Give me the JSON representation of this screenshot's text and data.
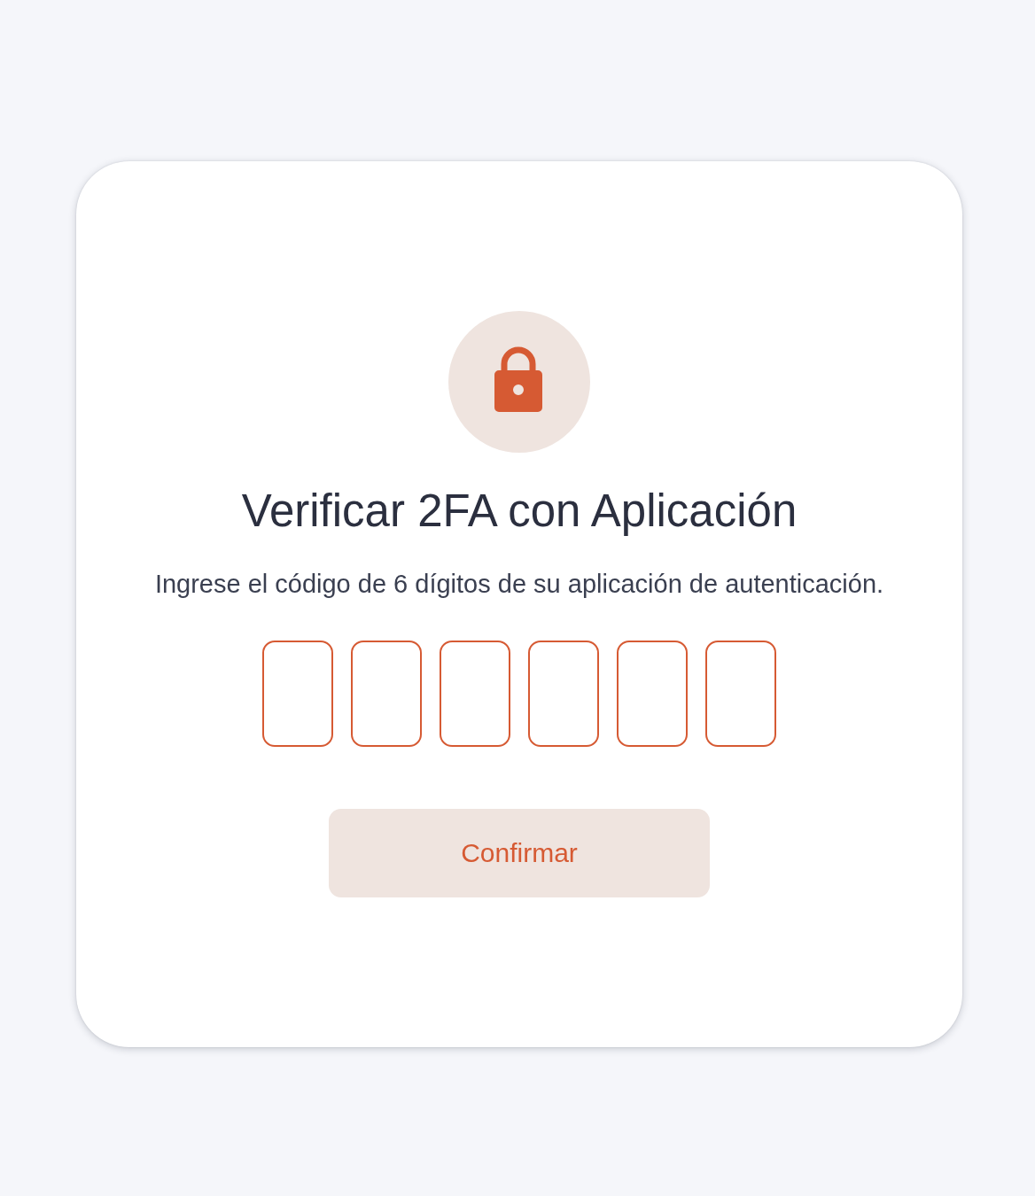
{
  "card": {
    "title": "Verificar 2FA con Aplicación",
    "description": "Ingrese el código de 6 dígitos de su aplicación de autenticación.",
    "code_inputs": [
      {
        "filled": false
      },
      {
        "filled": false
      },
      {
        "filled": false
      },
      {
        "filled": false
      },
      {
        "filled": false
      },
      {
        "filled": false
      }
    ],
    "button": {
      "label": "Confirmar"
    }
  }
}
